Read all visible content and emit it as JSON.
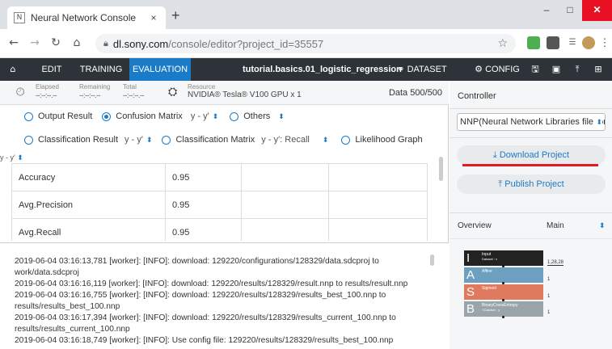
{
  "browser": {
    "tab_title": "Neural Network Console",
    "tab_favicon": "N",
    "tab_close": "×",
    "new_tab": "+",
    "url_host": "dl.sony.com",
    "url_path": "/console/editor?project_id=35557",
    "window_minimize": "–",
    "window_maximize": "□",
    "window_close": "✕"
  },
  "appnav": {
    "edit": "EDIT",
    "training": "TRAINING",
    "evaluation": "EVALUATION",
    "project_name": "tutorial.basics.01_logistic_regression",
    "dataset": "DATASET",
    "config": "CONFIG"
  },
  "status": {
    "elapsed_label": "Elapsed",
    "elapsed_value": "--:--:--.--",
    "remaining_label": "Remaining",
    "remaining_value": "--:--:--.--",
    "total_label": "Total",
    "total_value": "--:--:--.--",
    "resource_label": "Resource",
    "resource_value": "NVIDIA® Tesla® V100 GPU x 1",
    "data_count": "Data  500/500"
  },
  "options": {
    "output_result": "Output Result",
    "confusion_matrix": "Confusion Matrix",
    "confusion_select": "y - y'",
    "others": "Others",
    "classification_result": "Classification Result",
    "classification_result_select": "y - y'",
    "classification_matrix": "Classification Matrix",
    "classification_matrix_select": "y - y': Recall",
    "likelihood_graph": "Likelihood Graph",
    "selected": "Confusion Matrix"
  },
  "table_label": "y - y'",
  "metrics": [
    {
      "name": "Accuracy",
      "value": "0.95"
    },
    {
      "name": "Avg.Precision",
      "value": "0.95"
    },
    {
      "name": "Avg.Recall",
      "value": "0.95"
    }
  ],
  "log_lines": [
    "2019-06-04 03:16:13,781 [worker]: [INFO]: download: 129220/configurations/128329/data.sdcproj to",
    "work/data.sdcproj",
    "2019-06-04 03:16:16,119 [worker]: [INFO]: download: 129220/results/128329/result.nnp to results/result.nnp",
    "2019-06-04 03:16:16,755 [worker]: [INFO]: download: 129220/results/128329/results_best_100.nnp to",
    "results/results_best_100.nnp",
    "2019-06-04 03:16:17,394 [worker]: [INFO]: download: 129220/results/128329/results_current_100.nnp to",
    "results/results_current_100.nnp",
    "2019-06-04 03:16:18,749 [worker]: [INFO]: Use config file: 129220/results/128329/results_best_100.nnp"
  ],
  "controller": {
    "title": "Controller",
    "format_select": "NNP(Neural Network Libraries file forr",
    "download_project": "Download Project",
    "publish_project": "Publish Project"
  },
  "overview": {
    "title": "Overview",
    "selector": "Main",
    "layers": [
      {
        "letter": "I",
        "name": "Input",
        "detail": "Dataset : x",
        "shape": "1,28,28"
      },
      {
        "letter": "A",
        "name": "Affine",
        "detail": "",
        "shape": "1"
      },
      {
        "letter": "S",
        "name": "Sigmoid",
        "detail": "",
        "shape": "1"
      },
      {
        "letter": "B",
        "name": "BinaryCrossEntropy",
        "detail": "T.Dataset : y",
        "shape": "1"
      }
    ]
  },
  "colors": {
    "accent": "#1a7cc9",
    "nav_bg": "#2d3338",
    "highlight_red": "#e01b24"
  }
}
